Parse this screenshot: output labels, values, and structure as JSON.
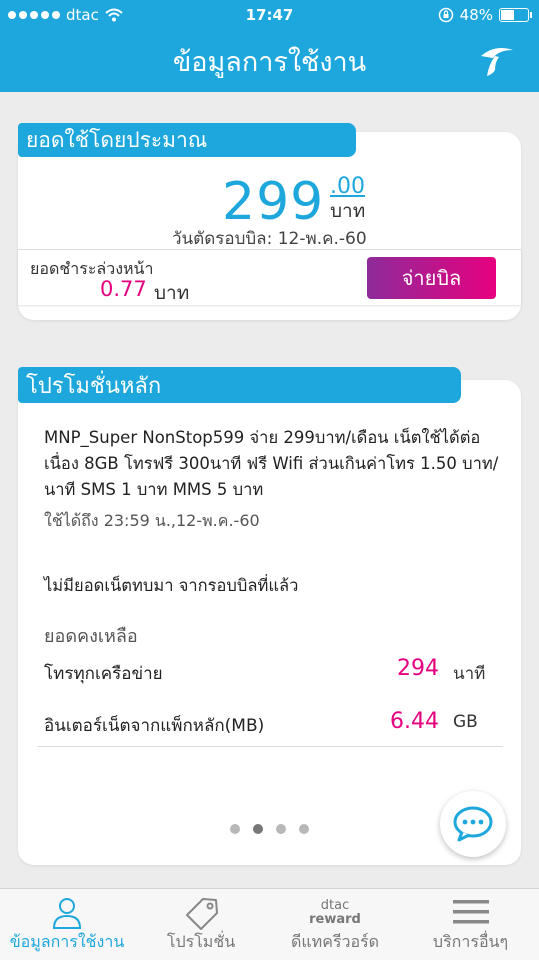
{
  "status_bar": {
    "carrier": "dtac",
    "time": "17:47",
    "battery": "48%",
    "battery_level": 0.48
  },
  "header": {
    "title": "ข้อมูลการใช้งาน",
    "logo_icon": "dtac-logo-icon"
  },
  "usage": {
    "tag_label": "ยอดใช้โดยประมาณ",
    "amount": "299",
    "decimals": ".00",
    "unit": "บาท",
    "cycle_text": "วันตัดรอบบิล: 12-พ.ค.-60",
    "advance_label": "ยอดชำระล่วงหน้า",
    "advance_amount": "0.77",
    "advance_unit": "บาท",
    "pay_button": "จ่ายบิล"
  },
  "promo": {
    "tag_label": "โปรโมชั่นหลัก",
    "description": "MNP_Super NonStop599 จ่าย 299บาท/เดือน เน็ตใช้ได้ต่อเนื่อง 8GB โทรฟรี 300นาที ฟรี Wifi ส่วนเกินค่าโทร 1.50 บาท/นาที SMS 1 บาท MMS 5 บาท",
    "expiry": "ใช้ได้ถึง 23:59 น.,12-พ.ค.-60",
    "no_rollover": "ไม่มียอดเน็ตทบมา จากรอบบิลที่แล้ว",
    "remaining_title": "ยอดคงเหลือ",
    "rows": [
      {
        "label": "โทรทุกเครือข่าย",
        "value": "294",
        "unit": "นาที"
      },
      {
        "label": "อินเตอร์เน็ตจากแพ็กหลัก(MB)",
        "value": "6.44",
        "unit": "GB"
      }
    ],
    "pager_count": 4,
    "pager_active": 2
  },
  "tabs": [
    {
      "label": "ข้อมูลการใช้งาน",
      "icon": "user-icon",
      "active": true
    },
    {
      "label": "โปรโมชั่น",
      "icon": "tag-icon",
      "active": false
    },
    {
      "label": "ดีแทครีวอร์ด",
      "icon": "dtac-reward-icon",
      "reward_brand": "dtac",
      "reward_word": "reward",
      "active": false
    },
    {
      "label": "บริการอื่นๆ",
      "icon": "menu-icon",
      "active": false
    }
  ],
  "colors": {
    "primary": "#1ea7dc",
    "accent": "#e4007f",
    "pay_gradient_start": "#8e2b9a",
    "pay_gradient_end": "#e7007f"
  }
}
